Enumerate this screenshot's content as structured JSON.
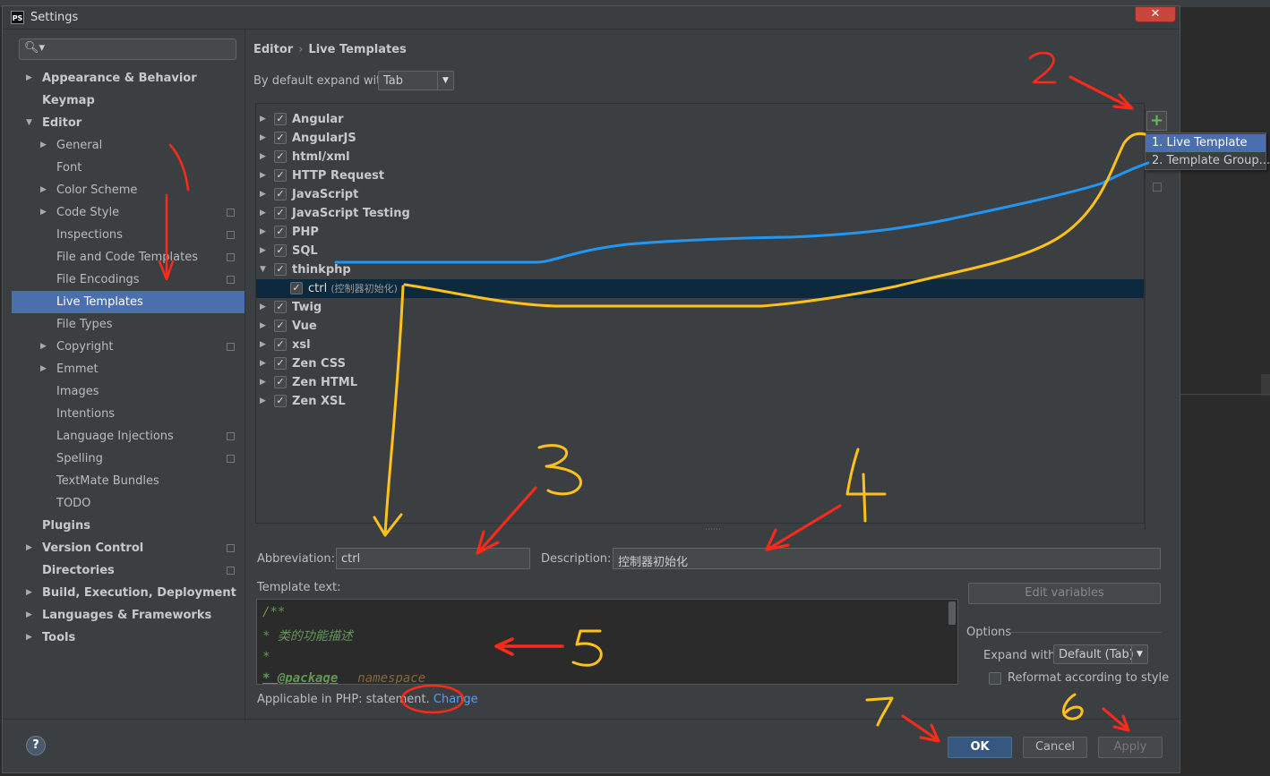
{
  "window": {
    "title": "Settings",
    "app_icon": "PS"
  },
  "search": {
    "icon": "search-icon"
  },
  "sidebar": {
    "items": [
      {
        "label": "Appearance & Behavior",
        "level": 0,
        "expander": "collapsed",
        "bold": true,
        "copy": false
      },
      {
        "label": "Keymap",
        "level": 0,
        "expander": "none",
        "bold": true,
        "copy": false
      },
      {
        "label": "Editor",
        "level": 0,
        "expander": "expanded",
        "bold": true,
        "copy": false
      },
      {
        "label": "General",
        "level": 1,
        "expander": "collapsed",
        "bold": false,
        "copy": false
      },
      {
        "label": "Font",
        "level": 1,
        "expander": "none",
        "bold": false,
        "copy": false
      },
      {
        "label": "Color Scheme",
        "level": 1,
        "expander": "collapsed",
        "bold": false,
        "copy": false
      },
      {
        "label": "Code Style",
        "level": 1,
        "expander": "collapsed",
        "bold": false,
        "copy": true
      },
      {
        "label": "Inspections",
        "level": 1,
        "expander": "none",
        "bold": false,
        "copy": true
      },
      {
        "label": "File and Code Templates",
        "level": 1,
        "expander": "none",
        "bold": false,
        "copy": true
      },
      {
        "label": "File Encodings",
        "level": 1,
        "expander": "none",
        "bold": false,
        "copy": true
      },
      {
        "label": "Live Templates",
        "level": 1,
        "expander": "none",
        "bold": false,
        "copy": false,
        "selected": true
      },
      {
        "label": "File Types",
        "level": 1,
        "expander": "none",
        "bold": false,
        "copy": false
      },
      {
        "label": "Copyright",
        "level": 1,
        "expander": "collapsed",
        "bold": false,
        "copy": true
      },
      {
        "label": "Emmet",
        "level": 1,
        "expander": "collapsed",
        "bold": false,
        "copy": false
      },
      {
        "label": "Images",
        "level": 1,
        "expander": "none",
        "bold": false,
        "copy": false
      },
      {
        "label": "Intentions",
        "level": 1,
        "expander": "none",
        "bold": false,
        "copy": false
      },
      {
        "label": "Language Injections",
        "level": 1,
        "expander": "none",
        "bold": false,
        "copy": true
      },
      {
        "label": "Spelling",
        "level": 1,
        "expander": "none",
        "bold": false,
        "copy": true
      },
      {
        "label": "TextMate Bundles",
        "level": 1,
        "expander": "none",
        "bold": false,
        "copy": false
      },
      {
        "label": "TODO",
        "level": 1,
        "expander": "none",
        "bold": false,
        "copy": false
      },
      {
        "label": "Plugins",
        "level": 0,
        "expander": "none",
        "bold": true,
        "copy": false
      },
      {
        "label": "Version Control",
        "level": 0,
        "expander": "collapsed",
        "bold": true,
        "copy": true
      },
      {
        "label": "Directories",
        "level": 0,
        "expander": "none",
        "bold": true,
        "copy": true
      },
      {
        "label": "Build, Execution, Deployment",
        "level": 0,
        "expander": "collapsed",
        "bold": true,
        "copy": false
      },
      {
        "label": "Languages & Frameworks",
        "level": 0,
        "expander": "collapsed",
        "bold": true,
        "copy": false
      },
      {
        "label": "Tools",
        "level": 0,
        "expander": "collapsed",
        "bold": true,
        "copy": false
      }
    ]
  },
  "breadcrumb": {
    "parent": "Editor",
    "separator": "›",
    "current": "Live Templates"
  },
  "expand_default": {
    "label": "By default expand with",
    "value": "Tab"
  },
  "template_groups": [
    {
      "label": "Angular",
      "expander": "collapsed",
      "checked": true
    },
    {
      "label": "AngularJS",
      "expander": "collapsed",
      "checked": true
    },
    {
      "label": "html/xml",
      "expander": "collapsed",
      "checked": true
    },
    {
      "label": "HTTP Request",
      "expander": "collapsed",
      "checked": true
    },
    {
      "label": "JavaScript",
      "expander": "collapsed",
      "checked": true
    },
    {
      "label": "JavaScript Testing",
      "expander": "collapsed",
      "checked": true
    },
    {
      "label": "PHP",
      "expander": "collapsed",
      "checked": true
    },
    {
      "label": "SQL",
      "expander": "collapsed",
      "checked": true
    },
    {
      "label": "thinkphp",
      "expander": "expanded",
      "checked": true
    },
    {
      "label": "ctrl",
      "desc": "(控制器初始化)",
      "child": true,
      "checked": true,
      "selected": true
    },
    {
      "label": "Twig",
      "expander": "collapsed",
      "checked": true
    },
    {
      "label": "Vue",
      "expander": "collapsed",
      "checked": true
    },
    {
      "label": "xsl",
      "expander": "collapsed",
      "checked": true
    },
    {
      "label": "Zen CSS",
      "expander": "collapsed",
      "checked": true
    },
    {
      "label": "Zen HTML",
      "expander": "collapsed",
      "checked": true
    },
    {
      "label": "Zen XSL",
      "expander": "collapsed",
      "checked": true
    }
  ],
  "toolbar": {
    "add_icon": "plus-icon"
  },
  "add_menu": {
    "items": [
      "1. Live Template",
      "2. Template Group..."
    ]
  },
  "abbreviation": {
    "label": "Abbreviation:",
    "value": "ctrl"
  },
  "description": {
    "label": "Description:",
    "value": "控制器初始化"
  },
  "template_text": {
    "label": "Template text:",
    "lines": [
      "/**",
      " * 类的功能描述",
      " *",
      " * @package"
    ],
    "namespace_var": "namespace"
  },
  "edit_variables": "Edit variables",
  "options": {
    "title": "Options",
    "expand_with_label": "Expand with",
    "expand_with_value": "Default (Tab)",
    "reformat_label": "Reformat according to style",
    "reformat_checked": false
  },
  "applicable": {
    "text": "Applicable in PHP: statement.",
    "link": "Change"
  },
  "buttons": {
    "ok": "OK",
    "cancel": "Cancel",
    "apply": "Apply",
    "help": "?"
  },
  "annotations": {
    "numbers": [
      "2",
      "3",
      "4",
      "5",
      "6",
      "7"
    ],
    "colors": {
      "red": "#ff2a1a",
      "yellow": "#ffc21a",
      "blue": "#2196f3"
    }
  },
  "colors": {
    "dialog_bg": "#3c3f41",
    "selection": "#4b6eaf",
    "tree_selection": "#0d293e",
    "accent_green": "#5fbf55",
    "link": "#589df6"
  }
}
